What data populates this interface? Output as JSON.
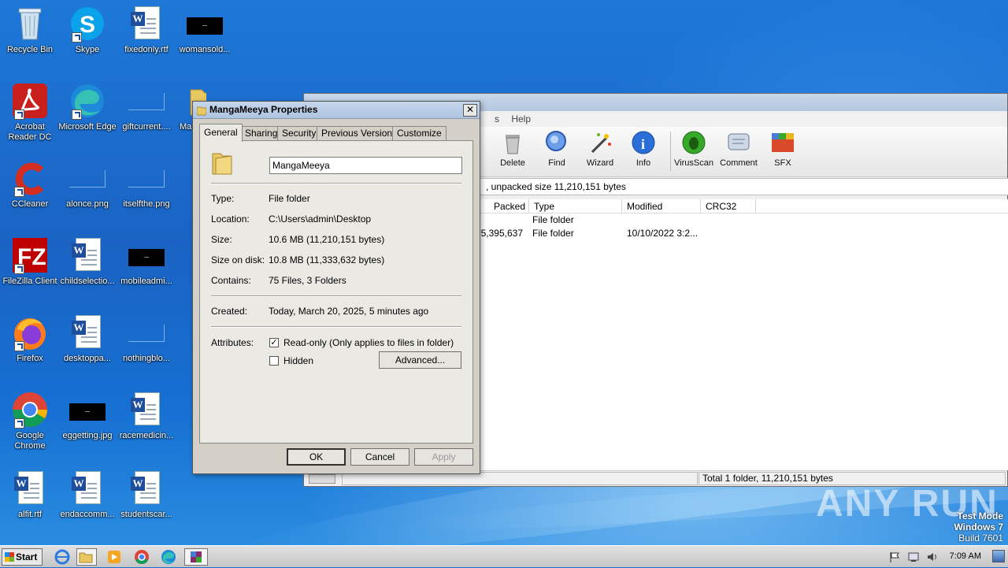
{
  "desktop": {
    "icons": [
      {
        "label": "Recycle Bin",
        "icon": "recycle-bin-icon"
      },
      {
        "label": "Skype",
        "icon": "skype-icon"
      },
      {
        "label": "fixedonly.rtf",
        "icon": "word-document-icon"
      },
      {
        "label": "womansold...",
        "icon": "image-thumbnail-icon"
      },
      {
        "label": "Acrobat Reader DC",
        "icon": "acrobat-icon"
      },
      {
        "label": "Microsoft Edge",
        "icon": "edge-icon"
      },
      {
        "label": "giftcurrent....",
        "icon": "image-thumbnail-icon"
      },
      {
        "label": "Ma",
        "icon": "folder-icon"
      },
      {
        "label": "CCleaner",
        "icon": "ccleaner-icon"
      },
      {
        "label": "alonce.png",
        "icon": "image-thumbnail-icon"
      },
      {
        "label": "itselfthe.png",
        "icon": "image-thumbnail-icon"
      },
      {
        "label": "FileZilla Client",
        "icon": "filezilla-icon"
      },
      {
        "label": "childselectio...",
        "icon": "word-document-icon"
      },
      {
        "label": "mobileadmi...",
        "icon": "image-thumbnail-icon"
      },
      {
        "label": "Firefox",
        "icon": "firefox-icon"
      },
      {
        "label": "desktoppa...",
        "icon": "word-document-icon"
      },
      {
        "label": "nothingblo...",
        "icon": "image-thumbnail-icon"
      },
      {
        "label": "Google Chrome",
        "icon": "chrome-icon"
      },
      {
        "label": "eggetting.jpg",
        "icon": "image-thumbnail-icon"
      },
      {
        "label": "racemedicin...",
        "icon": "word-document-icon"
      },
      {
        "label": "alfit.rtf",
        "icon": "word-document-icon"
      },
      {
        "label": "endaccomm...",
        "icon": "word-document-icon"
      },
      {
        "label": "studentscar...",
        "icon": "word-document-icon"
      }
    ]
  },
  "winrar": {
    "menu_help": "Help",
    "menu_partial": "s",
    "toolbar": [
      "Delete",
      "Find",
      "Wizard",
      "Info",
      "VirusScan",
      "Comment",
      "SFX"
    ],
    "address": ", unpacked size 11,210,151 bytes",
    "columns": [
      "Packed",
      "Type",
      "Modified",
      "CRC32"
    ],
    "rows": [
      {
        "packed": "",
        "type": "File folder",
        "modified": ""
      },
      {
        "packed": "5,395,637",
        "type": "File folder",
        "modified": "10/10/2022 3:2..."
      }
    ],
    "status": "Total 1 folder, 11,210,151 bytes"
  },
  "dialog": {
    "title": "MangaMeeya Properties",
    "close": "✕",
    "tabs": [
      "General",
      "Sharing",
      "Security",
      "Previous Versions",
      "Customize"
    ],
    "name_value": "MangaMeeya",
    "fields": [
      {
        "label": "Type:",
        "value": "File folder"
      },
      {
        "label": "Location:",
        "value": "C:\\Users\\admin\\Desktop"
      },
      {
        "label": "Size:",
        "value": "10.6 MB (11,210,151 bytes)"
      },
      {
        "label": "Size on disk:",
        "value": "10.8 MB (11,333,632 bytes)"
      },
      {
        "label": "Contains:",
        "value": "75 Files, 3 Folders"
      }
    ],
    "created_label": "Created:",
    "created_value": "Today, March 20, 2025, 5 minutes ago",
    "attributes_label": "Attributes:",
    "readonly_label": "Read-only (Only applies to files in folder)",
    "readonly_checked": "✓",
    "hidden_label": "Hidden",
    "advanced_button": "Advanced...",
    "ok_button": "OK",
    "cancel_button": "Cancel",
    "apply_button": "Apply"
  },
  "taskbar": {
    "start": "Start",
    "clock": "7:09 AM"
  },
  "overlay": {
    "watermark": "ANY RUN",
    "testmode_line1": "Test Mode",
    "testmode_line2": "Windows 7",
    "testmode_line3": "Build 7601"
  }
}
